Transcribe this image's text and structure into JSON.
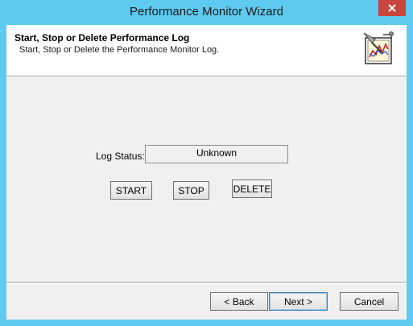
{
  "window": {
    "title": "Performance Monitor Wizard",
    "close_icon": "close-x-icon"
  },
  "header": {
    "title": "Start, Stop or Delete Performance Log",
    "subtitle": "Start, Stop or Delete the Performance Monitor Log.",
    "icon": "performance-monitor-wizard-icon"
  },
  "log_status": {
    "label": "Log Status:",
    "value": "Unknown"
  },
  "actions": {
    "start": "START",
    "stop": "STOP",
    "delete": "DELETE"
  },
  "footer": {
    "back": "< Back",
    "next": "Next >",
    "cancel": "Cancel"
  },
  "colors": {
    "frame": "#5ecaf0",
    "close_button": "#c7463b",
    "client_bg": "#f0f0f0"
  }
}
